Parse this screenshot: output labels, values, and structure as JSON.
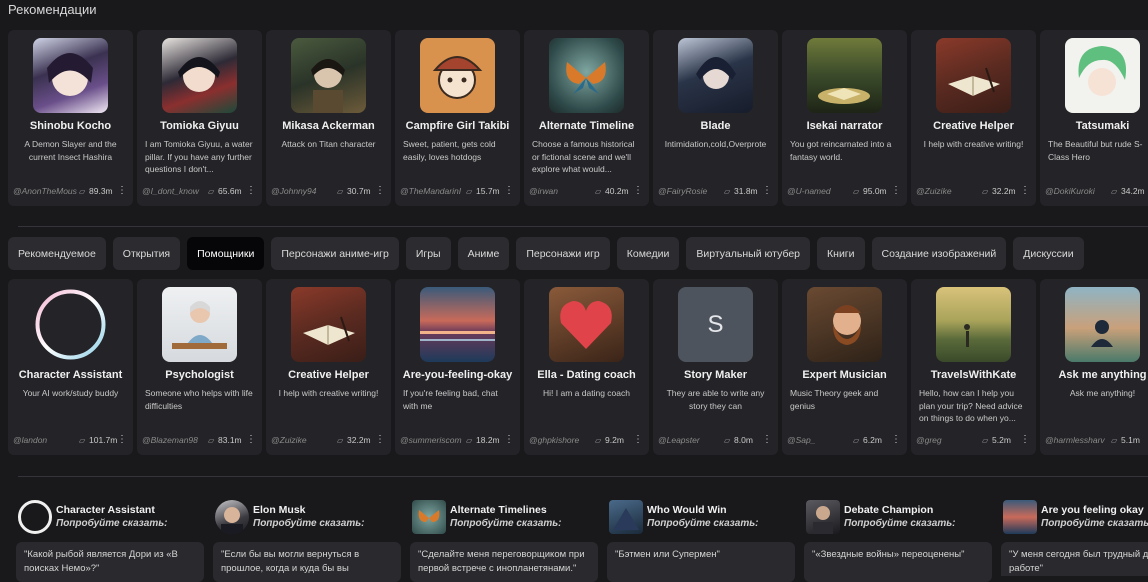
{
  "section_title": "Рекомендации",
  "ui": {
    "chat_icon": "chat-bubble-icon",
    "more_icon": "vertical-ellipsis-icon"
  },
  "recommended": [
    {
      "name": "Shinobu Kocho",
      "desc": "A Demon Slayer and the current Insect Hashira",
      "author": "@AnonTheMous",
      "count": "89.3m"
    },
    {
      "name": "Tomioka Giyuu",
      "desc": "I am Tomioka Giyuu, a water pillar. If you have any further questions I don't...",
      "author": "@I_dont_know",
      "count": "65.6m"
    },
    {
      "name": "Mikasa Ackerman",
      "desc": "Attack on Titan character",
      "author": "@Johnny94",
      "count": "30.7m"
    },
    {
      "name": "Campfire Girl Takibi",
      "desc": "Sweet, patient, gets cold easily, loves hotdogs",
      "author": "@TheMandarinI",
      "count": "15.7m"
    },
    {
      "name": "Alternate Timeline",
      "desc": "Choose a famous historical or fictional scene and we'll explore what would...",
      "author": "@irwan",
      "count": "40.2m"
    },
    {
      "name": "Blade",
      "desc": "Intimidation,cold,Overprote",
      "author": "@FairyRosie",
      "count": "31.8m"
    },
    {
      "name": "Isekai narrator",
      "desc": "You got reincarnated into a fantasy world.",
      "author": "@U-named",
      "count": "95.0m"
    },
    {
      "name": "Creative Helper",
      "desc": "I help with creative writing!",
      "author": "@Zuizike",
      "count": "32.2m"
    },
    {
      "name": "Tatsumaki",
      "desc": "The Beautiful but rude S-Class Hero",
      "author": "@DokiKuroki",
      "count": "34.2m"
    }
  ],
  "tabs": [
    {
      "label": "Рекомендуемое",
      "active": false
    },
    {
      "label": "Открытия",
      "active": false
    },
    {
      "label": "Помощники",
      "active": true
    },
    {
      "label": "Персонажи аниме-игр",
      "active": false
    },
    {
      "label": "Игры",
      "active": false
    },
    {
      "label": "Аниме",
      "active": false
    },
    {
      "label": "Персонажи игр",
      "active": false
    },
    {
      "label": "Комедии",
      "active": false
    },
    {
      "label": "Виртуальный ютубер",
      "active": false
    },
    {
      "label": "Книги",
      "active": false
    },
    {
      "label": "Создание изображений",
      "active": false
    },
    {
      "label": "Дискуссии",
      "active": false
    }
  ],
  "helpers": [
    {
      "name": "Character Assistant",
      "desc": "Your AI work/study buddy",
      "author": "@landon",
      "count": "101.7m"
    },
    {
      "name": "Psychologist",
      "desc": "Someone who helps with life difficulties",
      "author": "@Blazeman98",
      "count": "83.1m"
    },
    {
      "name": "Creative Helper",
      "desc": "I help with creative writing!",
      "author": "@Zuizike",
      "count": "32.2m"
    },
    {
      "name": "Are-you-feeling-okay",
      "desc": "If you're feeling bad, chat with me",
      "author": "@summeriscom",
      "count": "18.2m"
    },
    {
      "name": "Ella - Dating coach",
      "desc": "Hi! I am a dating coach",
      "author": "@ghpkishore",
      "count": "9.2m"
    },
    {
      "name": "Story Maker",
      "desc": "They are able to write any story they can",
      "author": "@Leapster",
      "count": "8.0m",
      "letter": "S"
    },
    {
      "name": "Expert Musician",
      "desc": "Music Theory geek and genius",
      "author": "@Sap_",
      "count": "6.2m"
    },
    {
      "name": "TravelsWithKate",
      "desc": "Hello, how can I help you plan your trip? Need advice on things to do when yo...",
      "author": "@greg",
      "count": "5.2m"
    },
    {
      "name": "Ask me anything",
      "desc": "Ask me anything!",
      "author": "@harmlessharv",
      "count": "5.1m"
    }
  ],
  "prompts": [
    {
      "name": "Character Assistant",
      "try": "Попробуйте сказать:",
      "text": "\"Какой рыбой является Дори из «В поисках Немо»?\""
    },
    {
      "name": "Elon Musk",
      "try": "Попробуйте сказать:",
      "text": "\"Если бы вы могли вернуться в прошлое, когда и куда бы вы"
    },
    {
      "name": "Alternate Timelines",
      "try": "Попробуйте сказать:",
      "text": "\"Сделайте меня переговорщиком при первой встрече с инопланетянами.\""
    },
    {
      "name": "Who Would Win",
      "try": "Попробуйте сказать:",
      "text": "\"Бэтмен или Супермен\""
    },
    {
      "name": "Debate Champion",
      "try": "Попробуйте сказать:",
      "text": "\"«Звездные войны» переоценены\""
    },
    {
      "name": "Are you feeling okay",
      "try": "Попробуйте сказать:",
      "text": "\"У меня сегодня был трудный день на работе\""
    }
  ]
}
